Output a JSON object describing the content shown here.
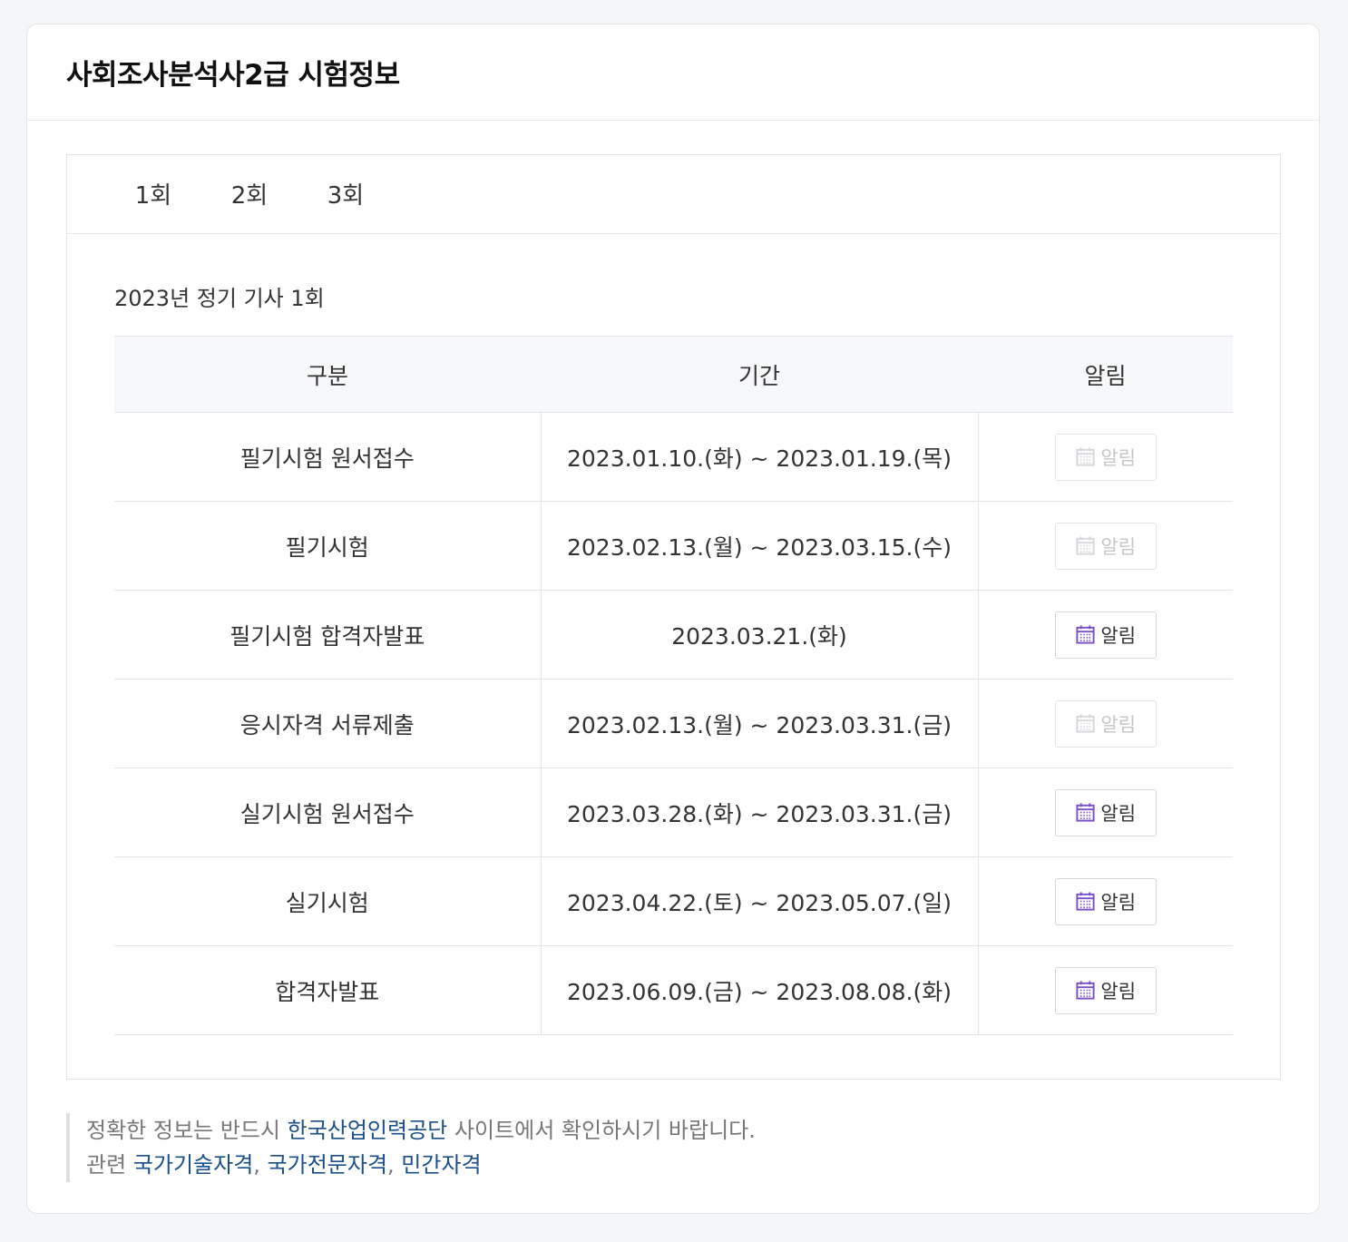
{
  "title": "사회조사분석사2급 시험정보",
  "tabs": [
    {
      "label": "1회",
      "active": true
    },
    {
      "label": "2회",
      "active": false
    },
    {
      "label": "3회",
      "active": false
    }
  ],
  "round_title": "2023년 정기 기사 1회",
  "table": {
    "headers": [
      "구분",
      "기간",
      "알림"
    ],
    "rows": [
      {
        "category": "필기시험 원서접수",
        "period": "2023.01.10.(화) ~ 2023.01.19.(목)",
        "alarm_label": "알림",
        "alarm_enabled": false
      },
      {
        "category": "필기시험",
        "period": "2023.02.13.(월) ~ 2023.03.15.(수)",
        "alarm_label": "알림",
        "alarm_enabled": false
      },
      {
        "category": "필기시험 합격자발표",
        "period": "2023.03.21.(화)",
        "alarm_label": "알림",
        "alarm_enabled": true
      },
      {
        "category": "응시자격 서류제출",
        "period": "2023.02.13.(월) ~ 2023.03.31.(금)",
        "alarm_label": "알림",
        "alarm_enabled": false
      },
      {
        "category": "실기시험 원서접수",
        "period": "2023.03.28.(화) ~ 2023.03.31.(금)",
        "alarm_label": "알림",
        "alarm_enabled": true
      },
      {
        "category": "실기시험",
        "period": "2023.04.22.(토) ~ 2023.05.07.(일)",
        "alarm_label": "알림",
        "alarm_enabled": true
      },
      {
        "category": "합격자발표",
        "period": "2023.06.09.(금) ~ 2023.08.08.(화)",
        "alarm_label": "알림",
        "alarm_enabled": true
      }
    ]
  },
  "note": {
    "line1_prefix": "정확한 정보는 반드시 ",
    "line1_link": "한국산업인력공단",
    "line1_suffix": " 사이트에서 확인하시기 바랍니다.",
    "line2_prefix": "관련 ",
    "links": [
      "국가기술자격",
      "국가전문자격",
      "민간자격"
    ],
    "separator": ", "
  },
  "colors": {
    "tab_active_underline": "#2db34a",
    "calendar_icon_active": "#7b4fc9",
    "calendar_icon_disabled": "#d5d7db",
    "link": "#1a4f8a"
  },
  "icons": {
    "alarm": "calendar-icon"
  }
}
